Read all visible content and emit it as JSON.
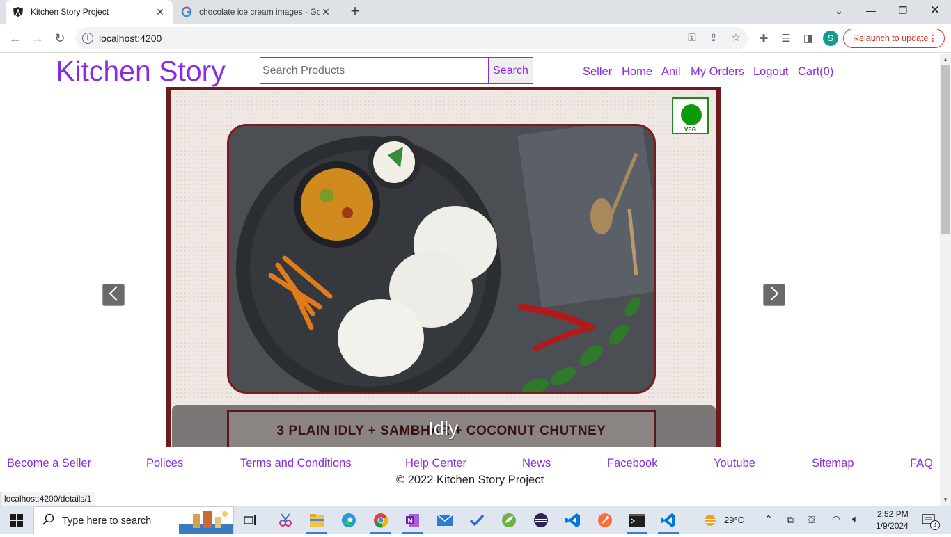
{
  "browser": {
    "tabs": [
      {
        "title": "Kitchen Story Project",
        "active": true,
        "favicon": "angular-icon"
      },
      {
        "title": "chocolate ice cream images - Go",
        "active": false,
        "favicon": "google-icon"
      }
    ],
    "url": "localhost:4200",
    "profile_initial": "S",
    "relaunch_label": "Relaunch to update",
    "status_url": "localhost:4200/details/1"
  },
  "header": {
    "brand": "Kitchen Story",
    "search_placeholder": "Search Products",
    "search_button": "Search",
    "nav": [
      "Seller",
      "Home",
      "Anil",
      "My Orders",
      "Logout",
      "Cart(0)"
    ]
  },
  "carousel": {
    "badge": "VEG",
    "menu_text": "3 PLAIN IDLY + SAMBHAR + COCONUT CHUTNEY",
    "caption": "Idly"
  },
  "footer": {
    "links": [
      "Become a Seller",
      "Polices",
      "Terms and Conditions",
      "Help Center",
      "News",
      "Facebook",
      "Youtube",
      "Sitemap",
      "FAQ"
    ],
    "copyright": "© 2022 Kitchen Story Project"
  },
  "taskbar": {
    "search_placeholder": "Type here to search",
    "weather": "29°C",
    "time": "2:52 PM",
    "date": "1/9/2024",
    "notifications": "4"
  },
  "colors": {
    "accent": "#8a2be2",
    "frame": "#6b1c1c",
    "veg": "#0a9a0a"
  }
}
